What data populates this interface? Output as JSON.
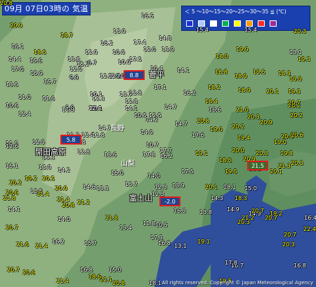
{
  "title": "09月 07日03時の 気温",
  "legend": {
    "text": "＜ 5 〜10〜15〜20〜25〜30〜35 ≦ (℃)",
    "colors": [
      "#1f2fd4",
      "#a8c8ff",
      "#ffffff",
      "#00b050",
      "#ffff00",
      "#ff9900",
      "#ff2a2a",
      "#9a2b9a"
    ]
  },
  "places": {
    "sugadaira": "菅平",
    "nagano": "長野",
    "yamanashi": "山梨",
    "kaida_kogen": "開田高原",
    "fujisan": "富士山"
  },
  "highlights": {
    "sugadaira": "8.8",
    "kaida_kogen": "5.8",
    "fujisan": "-2.0",
    "tokyo": "21.5"
  },
  "copyright": "All rights reserved. Copyright © Japan Meteorological Agency",
  "readings": [
    {
      "v": "20.9",
      "c": "yellow"
    },
    {
      "v": "16.5",
      "c": "white"
    },
    {
      "v": "13.9",
      "c": "white"
    },
    {
      "v": "14.8",
      "c": "white"
    },
    {
      "v": "15.4",
      "c": "white"
    },
    {
      "v": "15.4",
      "c": "white"
    },
    {
      "v": "20.3",
      "c": "yellow"
    },
    {
      "v": "18.7",
      "c": "yellow"
    },
    {
      "v": "16.2",
      "c": "white"
    },
    {
      "v": "12.0",
      "c": "white"
    },
    {
      "v": "12.9",
      "c": "white"
    },
    {
      "v": "13.9",
      "c": "white"
    },
    {
      "v": "19.9",
      "c": "yellow"
    },
    {
      "v": "13.1",
      "c": "white"
    },
    {
      "v": "16.1",
      "c": "white"
    },
    {
      "v": "18.5",
      "c": "yellow"
    },
    {
      "v": "15.6",
      "c": "white"
    },
    {
      "v": "13.8",
      "c": "white"
    },
    {
      "v": "15.2",
      "c": "white"
    },
    {
      "v": "17.4",
      "c": "white"
    },
    {
      "v": "19.3",
      "c": "yellow"
    },
    {
      "v": "17.0",
      "c": "white"
    },
    {
      "v": "15.9",
      "c": "white"
    },
    {
      "v": "15.7",
      "c": "white"
    },
    {
      "v": "10.9",
      "c": "white"
    },
    {
      "v": "10.9",
      "c": "white"
    },
    {
      "v": "17.5",
      "c": "white"
    },
    {
      "v": "18.0",
      "c": "yellow"
    },
    {
      "v": "18.9",
      "c": "yellow"
    },
    {
      "v": "14.4",
      "c": "white"
    },
    {
      "v": "12.9",
      "c": "white"
    },
    {
      "v": "9.7",
      "c": "light"
    },
    {
      "v": "10.4",
      "c": "white"
    },
    {
      "v": "17.1",
      "c": "white"
    },
    {
      "v": "19.5",
      "c": "yellow"
    },
    {
      "v": "18.3",
      "c": "yellow"
    },
    {
      "v": "12.3",
      "c": "white"
    },
    {
      "v": "12.3",
      "c": "white"
    },
    {
      "v": "9.9",
      "c": "light"
    },
    {
      "v": "9.9",
      "c": "light"
    },
    {
      "v": "14.1",
      "c": "white"
    },
    {
      "v": "18.8",
      "c": "yellow"
    },
    {
      "v": "19.9",
      "c": "yellow"
    },
    {
      "v": "10.6",
      "c": "white"
    },
    {
      "v": "11.6",
      "c": "white"
    },
    {
      "v": "9.9",
      "c": "light"
    },
    {
      "v": "10.1",
      "c": "white"
    },
    {
      "v": "13.7",
      "c": "white"
    },
    {
      "v": "18.2",
      "c": "yellow"
    },
    {
      "v": "18.9",
      "c": "yellow"
    },
    {
      "v": "19.3",
      "c": "yellow"
    },
    {
      "v": "13.5",
      "c": "white"
    },
    {
      "v": "10.1",
      "c": "white"
    },
    {
      "v": "12.8",
      "c": "white"
    },
    {
      "v": "12.8",
      "c": "white"
    },
    {
      "v": "14.7",
      "c": "white"
    },
    {
      "v": "16.2",
      "c": "white"
    },
    {
      "v": "20.1",
      "c": "yellow"
    },
    {
      "v": "20.2",
      "c": "yellow"
    },
    {
      "v": "11.0",
      "c": "white"
    },
    {
      "v": "11.9",
      "c": "white"
    },
    {
      "v": "12.3",
      "c": "white"
    },
    {
      "v": "14.1",
      "c": "white"
    },
    {
      "v": "18.4",
      "c": "yellow"
    },
    {
      "v": "20.7",
      "c": "yellow"
    },
    {
      "v": "21.0",
      "c": "yellow"
    },
    {
      "v": "20.3",
      "c": "yellow"
    },
    {
      "v": "12.4",
      "c": "white"
    },
    {
      "v": "12.4",
      "c": "white"
    },
    {
      "v": "10.5",
      "c": "white"
    },
    {
      "v": "14.2",
      "c": "white"
    },
    {
      "v": "12.5",
      "c": "white"
    },
    {
      "v": "14.7",
      "c": "white"
    },
    {
      "v": "16.6",
      "c": "white"
    },
    {
      "v": "20.8",
      "c": "yellow"
    },
    {
      "v": "20.2",
      "c": "yellow"
    },
    {
      "v": "14.7",
      "c": "white"
    },
    {
      "v": "14.9",
      "c": "white"
    },
    {
      "v": "17.6",
      "c": "white"
    },
    {
      "v": "19.0",
      "c": "yellow"
    },
    {
      "v": "20.2",
      "c": "yellow"
    },
    {
      "v": "20.9",
      "c": "yellow"
    },
    {
      "v": "20.6",
      "c": "yellow"
    },
    {
      "v": "11.5",
      "c": "white"
    },
    {
      "v": "11.3",
      "c": "white"
    },
    {
      "v": "12.4",
      "c": "white"
    },
    {
      "v": "11.8",
      "c": "white"
    },
    {
      "v": "15.8",
      "c": "white"
    },
    {
      "v": "17.7",
      "c": "white"
    },
    {
      "v": "19.4",
      "c": "yellow"
    },
    {
      "v": "19.0",
      "c": "yellow"
    },
    {
      "v": "20.6",
      "c": "yellow"
    },
    {
      "v": "12.6",
      "c": "white"
    },
    {
      "v": "12.9",
      "c": "white"
    },
    {
      "v": "10.7",
      "c": "white"
    },
    {
      "v": "17.8",
      "c": "white"
    },
    {
      "v": "19.1",
      "c": "yellow"
    },
    {
      "v": "20.0",
      "c": "yellow"
    },
    {
      "v": "20.3",
      "c": "yellow"
    },
    {
      "v": "19.8",
      "c": "yellow"
    },
    {
      "v": "15.1",
      "c": "white"
    },
    {
      "v": "13.3",
      "c": "white"
    },
    {
      "v": "12.8",
      "c": "white"
    },
    {
      "v": "13.6",
      "c": "white"
    },
    {
      "v": "16.2",
      "c": "white"
    },
    {
      "v": "18.6",
      "c": "yellow"
    },
    {
      "v": "20.9",
      "c": "yellow"
    },
    {
      "v": "20.3",
      "c": "yellow"
    },
    {
      "v": "21.3",
      "c": "yellow"
    },
    {
      "v": "13.9",
      "c": "white"
    },
    {
      "v": "14.2",
      "c": "white"
    },
    {
      "v": "15.0",
      "c": "white"
    },
    {
      "v": "17.5",
      "c": "white"
    },
    {
      "v": "19.5",
      "c": "yellow"
    },
    {
      "v": "20.1",
      "c": "yellow"
    },
    {
      "v": "20.3",
      "c": "yellow"
    },
    {
      "v": "19.2",
      "c": "yellow"
    },
    {
      "v": "20.5",
      "c": "yellow"
    },
    {
      "v": "13.5",
      "c": "white"
    },
    {
      "v": "14.6",
      "c": "white"
    },
    {
      "v": "14.0",
      "c": "white"
    },
    {
      "v": "18.1",
      "c": "white"
    },
    {
      "v": "20.1",
      "c": "yellow"
    },
    {
      "v": "20.2",
      "c": "yellow"
    },
    {
      "v": "20.9",
      "c": "yellow"
    },
    {
      "v": "13.3",
      "c": "white"
    },
    {
      "v": "13.7",
      "c": "white"
    },
    {
      "v": "13.9",
      "c": "white"
    },
    {
      "v": "14.3",
      "c": "white"
    },
    {
      "v": "18.3",
      "c": "yellow"
    },
    {
      "v": "21.4",
      "c": "yellow"
    },
    {
      "v": "21.4",
      "c": "yellow"
    },
    {
      "v": "12.3",
      "c": "white"
    },
    {
      "v": "12.3",
      "c": "white"
    },
    {
      "v": "15.0",
      "c": "white"
    },
    {
      "v": "14.9",
      "c": "white"
    },
    {
      "v": "19.2",
      "c": "yellow"
    },
    {
      "v": "20.6",
      "c": "yellow"
    },
    {
      "v": "20.8",
      "c": "yellow"
    },
    {
      "v": "14.1",
      "c": "white"
    },
    {
      "v": "6.0",
      "c": "light"
    },
    {
      "v": "13.8",
      "c": "white"
    },
    {
      "v": "14.9",
      "c": "white"
    },
    {
      "v": "20.7",
      "c": "yellow"
    },
    {
      "v": "20.7",
      "c": "yellow"
    },
    {
      "v": "21.8",
      "c": "yellow"
    },
    {
      "v": "21.2",
      "c": "yellow"
    },
    {
      "v": "14.0",
      "c": "white"
    },
    {
      "v": "16.3",
      "c": "white"
    },
    {
      "v": "11.8",
      "c": "white"
    },
    {
      "v": "19.1",
      "c": "yellow"
    },
    {
      "v": "20.7",
      "c": "yellow"
    },
    {
      "v": "21.8",
      "c": "yellow"
    },
    {
      "v": "20.7",
      "c": "yellow"
    },
    {
      "v": "13.4",
      "c": "white"
    },
    {
      "v": "10.5",
      "c": "white"
    },
    {
      "v": "17.3",
      "c": "white"
    },
    {
      "v": "20.3",
      "c": "yellow"
    },
    {
      "v": "21.2",
      "c": "yellow"
    },
    {
      "v": "22.4",
      "c": "yellow"
    },
    {
      "v": "21.6",
      "c": "yellow"
    },
    {
      "v": "21.4",
      "c": "yellow"
    },
    {
      "v": "16.2",
      "c": "white"
    },
    {
      "v": "15.7",
      "c": "white"
    },
    {
      "v": "16.8",
      "c": "white"
    },
    {
      "v": "16.4",
      "c": "white"
    },
    {
      "v": "20.7",
      "c": "yellow"
    },
    {
      "v": "20.6",
      "c": "yellow"
    },
    {
      "v": "16.8",
      "c": "white"
    },
    {
      "v": "15.0",
      "c": "white"
    },
    {
      "v": "13.1",
      "c": "white"
    },
    {
      "v": "16.7",
      "c": "white"
    },
    {
      "v": "20.3",
      "c": "yellow"
    },
    {
      "v": "21.4",
      "c": "yellow"
    },
    {
      "v": "22.1",
      "c": "yellow"
    },
    {
      "v": "20.8",
      "c": "yellow"
    },
    {
      "v": "18.6",
      "c": "yellow"
    },
    {
      "v": "18.1",
      "c": "white"
    },
    {
      "v": "17.8",
      "c": "white"
    },
    {
      "v": "16.8",
      "c": "white"
    },
    {
      "v": "19.5",
      "c": "yellow"
    },
    {
      "v": "21.8",
      "c": "yellow"
    },
    {
      "v": "20.8",
      "c": "yellow"
    }
  ]
}
